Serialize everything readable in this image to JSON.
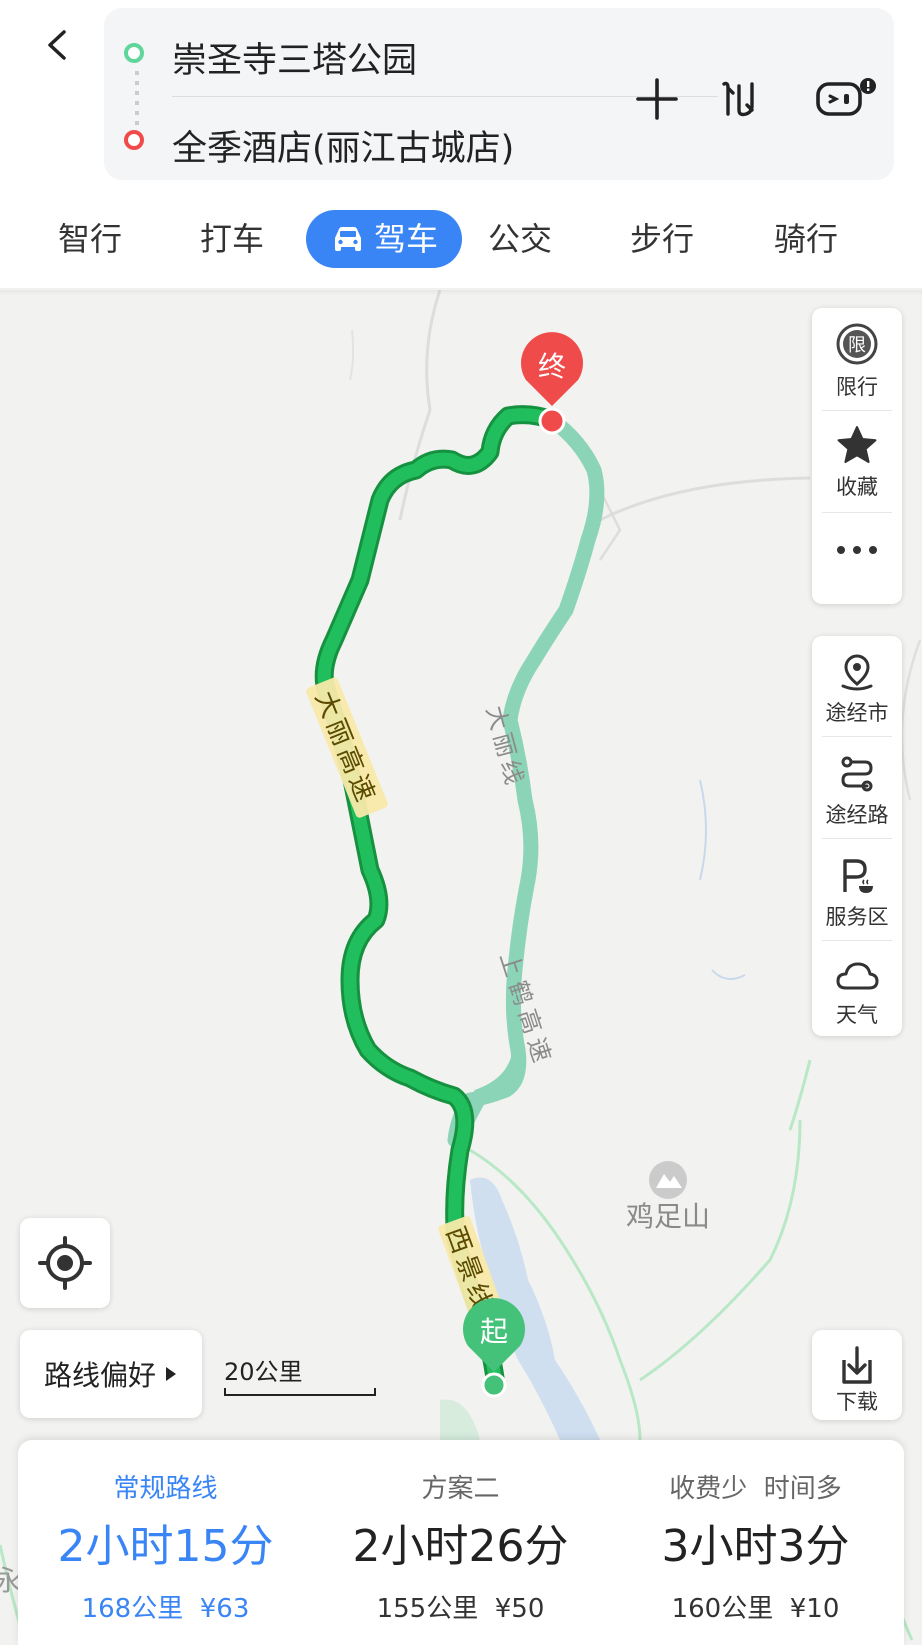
{
  "header": {
    "origin": "崇圣寺三塔公园",
    "destination": "全季酒店(丽江古城店)"
  },
  "tabs": [
    "智行",
    "打车",
    "驾车",
    "公交",
    "步行",
    "骑行"
  ],
  "active_tab": "驾车",
  "side_panel_top": [
    {
      "icon": "restriction-icon",
      "badge": "限",
      "label": "限行"
    },
    {
      "icon": "star-icon",
      "label": "收藏"
    },
    {
      "icon": "more-dots-icon",
      "label": ""
    }
  ],
  "side_panel_bottom": [
    {
      "icon": "city-pin-icon",
      "label": "途经市"
    },
    {
      "icon": "route-icon",
      "label": "途经路"
    },
    {
      "icon": "parking-service-icon",
      "label": "服务区"
    },
    {
      "icon": "cloud-icon",
      "label": "天气"
    }
  ],
  "map": {
    "start_marker": "起",
    "end_marker": "终",
    "road_labels": {
      "main_expressway": "大丽高速",
      "alt_road": "大丽线",
      "shanghe_expressway": "上鹤高速",
      "xijing": "西景线"
    },
    "poi": "鸡足山",
    "edge_text_left": "永",
    "scale": "20公里"
  },
  "route_preference": "路线偏好",
  "download": "下载",
  "routes": [
    {
      "label": "常规路线",
      "time": "2小时15分",
      "distance": "168公里",
      "fee": "¥63",
      "selected": true
    },
    {
      "label": "方案二",
      "time": "2小时26分",
      "distance": "155公里",
      "fee": "¥50",
      "selected": false
    },
    {
      "label": "收费少  时间多",
      "time": "3小时3分",
      "distance": "160公里",
      "fee": "¥10",
      "selected": false
    }
  ],
  "colors": {
    "accent": "#3a85f5",
    "main_route": "#1fb15a",
    "alt_route": "#8cd4b8",
    "end_marker": "#ef4b4b",
    "start_marker": "#45c27a"
  }
}
